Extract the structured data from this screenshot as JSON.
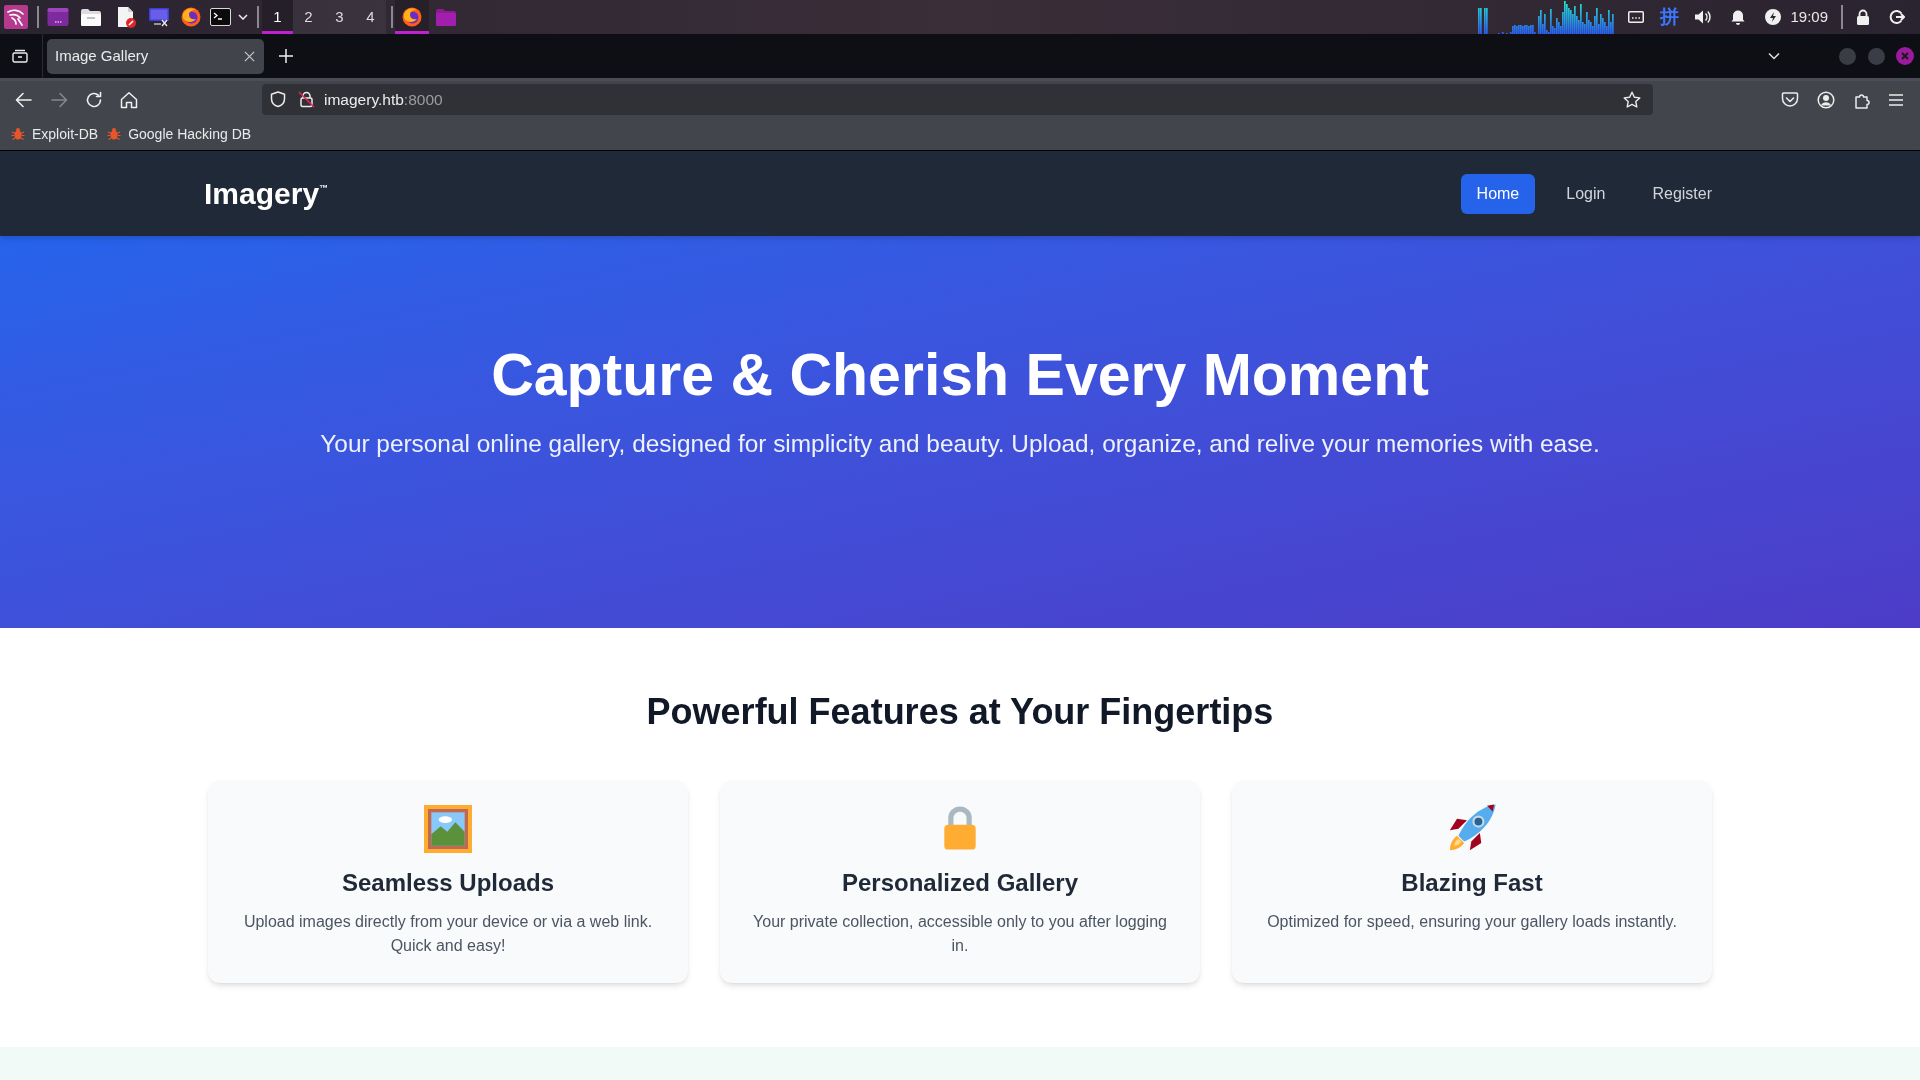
{
  "taskbar": {
    "workspaces": [
      {
        "label": "1",
        "selected": true
      },
      {
        "label": "2",
        "selected": false
      },
      {
        "label": "3",
        "selected": false
      },
      {
        "label": "4",
        "selected": false
      }
    ],
    "windows": [
      {
        "kind": "browser",
        "selected": true
      },
      {
        "kind": "folder",
        "selected": false
      }
    ],
    "input_method": "拼",
    "clock": "19:09"
  },
  "browser": {
    "tabs": [
      {
        "title": "Image Gallery",
        "selected": true
      }
    ],
    "nav_buttons": [
      {
        "kind": "back",
        "disabled": false
      },
      {
        "kind": "forward",
        "disabled": true
      },
      {
        "kind": "reload",
        "disabled": false
      },
      {
        "kind": "home",
        "disabled": false
      }
    ],
    "address": {
      "host": "imagery.htb",
      "port": ":8000"
    },
    "bookmarks": [
      "Exploit-DB",
      "Google Hacking DB"
    ]
  },
  "site": {
    "brand": "Imagery$^{™}$",
    "nav": [
      {
        "label": "Home",
        "selected": true
      },
      {
        "label": "Login",
        "selected": false
      },
      {
        "label": "Register",
        "selected": false
      }
    ]
  },
  "hero": {
    "title": "Capture & Cherish Every Moment",
    "subtitle": "Your personal online gallery, designed for simplicity and beauty. Upload, organize, and relive your memories with ease."
  },
  "features": {
    "heading": "Powerful Features at Your Fingertips",
    "cards": [
      {
        "kind": "picture",
        "title": "Seamless Uploads",
        "text": "Upload images directly from your device or via a web link. Quick and easy!"
      },
      {
        "kind": "lock",
        "title": "Personalized Gallery",
        "text": "Your private collection, accessible only to you after logging in."
      },
      {
        "kind": "rocket",
        "title": "Blazing Fast",
        "text": "Optimized for speed, ensuring your gallery loads instantly."
      }
    ]
  }
}
